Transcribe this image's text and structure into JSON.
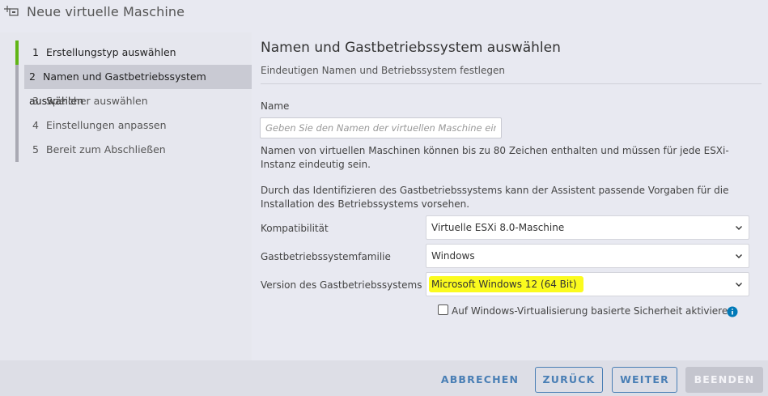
{
  "window": {
    "title": "Neue virtuelle Maschine",
    "icon": "add-vm-icon"
  },
  "wizard": {
    "steps": [
      {
        "num": "1",
        "label": "Erstellungstyp auswählen",
        "state": "done"
      },
      {
        "num": "2",
        "label": "Namen und Gastbetriebssystem auswählen",
        "state": "active"
      },
      {
        "num": "3",
        "label": "Speicher auswählen",
        "state": "pending"
      },
      {
        "num": "4",
        "label": "Einstellungen anpassen",
        "state": "pending"
      },
      {
        "num": "5",
        "label": "Bereit zum Abschließen",
        "state": "pending"
      }
    ]
  },
  "page": {
    "heading": "Namen und Gastbetriebssystem auswählen",
    "subheading": "Eindeutigen Namen und Betriebssystem festlegen",
    "name_label": "Name",
    "name_value": "",
    "name_placeholder": "Geben Sie den Namen der virtuellen Maschine ein.",
    "name_help": "Namen von virtuellen Maschinen können bis zu 80 Zeichen enthalten und müssen für jede ESXi-Instanz eindeutig sein.",
    "os_help": "Durch das Identifizieren des Gastbetriebssystems kann der Assistent passende Vorgaben für die Installation des Betriebssystems vorsehen.",
    "compat_label": "Kompatibilität",
    "compat_value": "Virtuelle ESXi 8.0-Maschine",
    "family_label": "Gastbetriebssystemfamilie",
    "family_value": "Windows",
    "version_label": "Version des Gastbetriebssystems",
    "version_value": "Microsoft Windows 12 (64 Bit)",
    "vbs_label": "Auf Windows-Virtualisierung basierte Sicherheit aktivieren",
    "vbs_checked": false,
    "highlight_color": "#fbfb1e"
  },
  "footer": {
    "cancel": "ABBRECHEN",
    "back": "ZURÜCK",
    "next": "WEITER",
    "finish": "BEENDEN"
  },
  "colors": {
    "accent": "#4a7fb5",
    "done": "#60b515",
    "info": "#0079b8"
  }
}
